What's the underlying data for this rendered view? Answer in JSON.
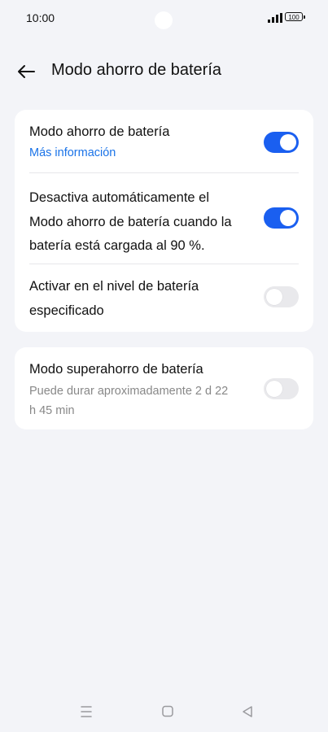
{
  "status": {
    "time": "10:00",
    "battery": "100",
    "signal_icon": "cellular-signal-icon",
    "battery_icon": "battery-icon"
  },
  "header": {
    "title": "Modo ahorro de batería",
    "back_icon": "arrow-left-icon"
  },
  "card1": {
    "rows": [
      {
        "title": "Modo ahorro de batería",
        "link": "Más información",
        "toggle": true
      },
      {
        "title_lines": [
          "Desactiva automáticamente el",
          "Modo ahorro de batería cuando la",
          "batería está cargada al 90 %."
        ],
        "toggle": true
      },
      {
        "title_lines": [
          "Activar en el nivel de batería",
          "especificado"
        ],
        "toggle": false
      }
    ]
  },
  "card2": {
    "title": "Modo superahorro de batería",
    "subtitle_lines": [
      "Puede durar aproximadamente 2 d 22",
      "h 45 min"
    ],
    "toggle": false
  },
  "navbar": {
    "menu_icon": "menu-icon",
    "home_icon": "home-icon",
    "back_icon": "back-triangle-icon"
  },
  "colors": {
    "accent": "#1a5ff0",
    "link": "#1a73e8",
    "background": "#f3f4f8",
    "card": "#ffffff"
  }
}
